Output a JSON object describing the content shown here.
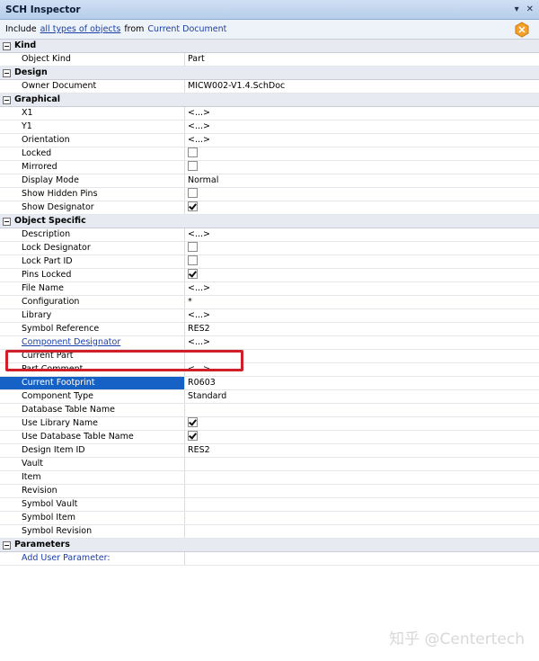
{
  "window": {
    "title": "SCH Inspector",
    "dropdown_glyph": "▾",
    "close_glyph": "✕"
  },
  "toolbar": {
    "include_label": "Include",
    "filter_link": "all types of objects",
    "from_label": "from",
    "scope": "Current Document"
  },
  "sections": [
    {
      "title": "Kind",
      "rows": [
        {
          "name": "Object Kind",
          "value": "Part"
        }
      ]
    },
    {
      "title": "Design",
      "rows": [
        {
          "name": "Owner Document",
          "value": "MICW002-V1.4.SchDoc"
        }
      ]
    },
    {
      "title": "Graphical",
      "rows": [
        {
          "name": "X1",
          "value": "<...>"
        },
        {
          "name": "Y1",
          "value": "<...>"
        },
        {
          "name": "Orientation",
          "value": "<...>"
        },
        {
          "name": "Locked",
          "checkbox": false
        },
        {
          "name": "Mirrored",
          "checkbox": false
        },
        {
          "name": "Display Mode",
          "value": "Normal"
        },
        {
          "name": "Show Hidden Pins",
          "checkbox": false
        },
        {
          "name": "Show Designator",
          "checkbox": true
        }
      ]
    },
    {
      "title": "Object Specific",
      "rows": [
        {
          "name": "Description",
          "value": "<...>"
        },
        {
          "name": "Lock Designator",
          "checkbox": false
        },
        {
          "name": "Lock Part ID",
          "checkbox": false
        },
        {
          "name": "Pins Locked",
          "checkbox": true
        },
        {
          "name": "File Name",
          "value": "<...>"
        },
        {
          "name": "Configuration",
          "value": "*"
        },
        {
          "name": "Library",
          "value": "<...>"
        },
        {
          "name": "Symbol Reference",
          "value": "RES2"
        },
        {
          "name": "Component Designator",
          "value": "<...>",
          "link": true
        },
        {
          "name": "Current Part",
          "value": ""
        },
        {
          "name": "Part Comment",
          "value": "<...>"
        },
        {
          "name": "Current Footprint",
          "value": "R0603",
          "selected": true
        },
        {
          "name": "Component Type",
          "value": "Standard"
        },
        {
          "name": "Database Table Name",
          "value": ""
        },
        {
          "name": "Use Library Name",
          "checkbox": true
        },
        {
          "name": "Use Database Table Name",
          "checkbox": true
        },
        {
          "name": "Design Item ID",
          "value": "RES2"
        },
        {
          "name": "Vault",
          "value": ""
        },
        {
          "name": "Item",
          "value": ""
        },
        {
          "name": "Revision",
          "value": ""
        },
        {
          "name": "Symbol Vault",
          "value": ""
        },
        {
          "name": "Symbol Item",
          "value": ""
        },
        {
          "name": "Symbol Revision",
          "value": ""
        }
      ]
    },
    {
      "title": "Parameters",
      "rows": [
        {
          "name": "Add User Parameter:",
          "value": "",
          "paramlink": true
        }
      ]
    }
  ],
  "watermark": "知乎 @Centertech",
  "colors": {
    "selection": "#1661c5",
    "highlight_box": "#d11f2a",
    "link": "#1a3ea8"
  }
}
